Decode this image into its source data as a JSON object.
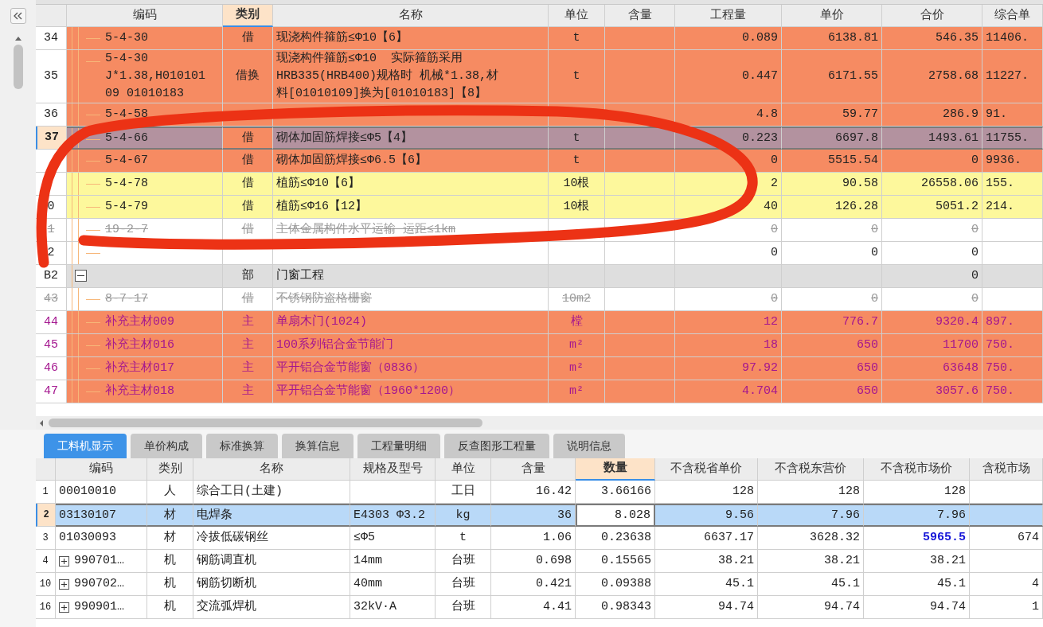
{
  "top_grid": {
    "columns": [
      {
        "label": "编码",
        "highlighted": false
      },
      {
        "label": "类别",
        "highlighted": true
      },
      {
        "label": "名称",
        "highlighted": false
      },
      {
        "label": "单位",
        "highlighted": false
      },
      {
        "label": "含量",
        "highlighted": false
      },
      {
        "label": "工程量",
        "highlighted": false
      },
      {
        "label": "单价",
        "highlighted": false
      },
      {
        "label": "合价",
        "highlighted": false
      },
      {
        "label": "综合单",
        "highlighted": false
      }
    ],
    "rows": [
      {
        "num": "34",
        "kind": "quota",
        "color": "#f68b62",
        "selected": false,
        "code": "5-4-30",
        "type": "借",
        "name": "现浇构件箍筋≤Φ10【6】",
        "unit": "t",
        "quantity": "0.089",
        "unit_price": "6138.81",
        "total": "546.35",
        "composite": "11406."
      },
      {
        "num": "35",
        "kind": "quota",
        "color": "#f68b62",
        "selected": false,
        "code": "5-4-30\nJ*1.38,H010101\n09 01010183",
        "type": "借换",
        "name_lines": [
          "现浇构件箍筋≤Φ10  实际箍筋采用",
          "HRB335(HRB400)规格时 机械*1.38,材",
          "料[01010109]换为[01010183]【8】"
        ],
        "unit": "t",
        "quantity": "0.447",
        "unit_price": "6171.55",
        "total": "2758.68",
        "composite": "11227."
      },
      {
        "num": "36",
        "kind": "quota",
        "color": "#f68b62",
        "selected": false,
        "code": "5-4-58",
        "quantity": "4.8",
        "unit_price": "59.77",
        "total": "286.9",
        "composite": "91."
      },
      {
        "num": "37",
        "kind": "quota",
        "color": "#f68b62",
        "selected": true,
        "code": "5-4-66",
        "type": "借",
        "name": "砌体加固筋焊接≤Φ5【4】",
        "unit": "t",
        "quantity": "0.223",
        "unit_price": "6697.8",
        "total": "1493.61",
        "composite": "11755."
      },
      {
        "kind": "quota",
        "color": "#f68b62",
        "selected": false,
        "code": "5-4-67",
        "type": "借",
        "name": "砌体加固筋焊接≤Φ6.5【6】",
        "unit": "t",
        "quantity": "0",
        "unit_price": "5515.54",
        "total": "0",
        "composite": "9936."
      },
      {
        "kind": "quota",
        "color": "#fdf89c",
        "selected": false,
        "code": "5-4-78",
        "type": "借",
        "name": "植筋≤Φ10【6】",
        "unit": "10根",
        "quantity": "2",
        "unit_price": "90.58",
        "total": "26558.06",
        "composite": "155."
      },
      {
        "num": "0",
        "kind": "quota",
        "color": "#fdf89c",
        "selected": false,
        "code": "5-4-79",
        "type": "借",
        "name": "植筋≤Φ16【12】",
        "unit": "10根",
        "quantity": "40",
        "unit_price": "126.28",
        "total": "5051.2",
        "composite": "214."
      },
      {
        "num": "1",
        "kind": "voided",
        "color": "#ffffff",
        "selected": false,
        "code": "19-2-7",
        "type": "借",
        "name": "主体金属构件水平运输 运距≤1km",
        "quantity": "0",
        "unit_price": "0",
        "total": "0"
      },
      {
        "num": "2",
        "kind": "quota",
        "color": "#ffffff",
        "selected": false,
        "quantity": "0",
        "unit_price": "0",
        "total": "0"
      },
      {
        "num": "B2",
        "kind": "section",
        "color": "#dedede",
        "selected": false,
        "type": "部",
        "name": "门窗工程",
        "total": "0"
      },
      {
        "num": "43",
        "kind": "voided",
        "color": "#ffffff",
        "selected": false,
        "code": "8-7-17",
        "type": "借",
        "name": "不锈钢防盗格栅窗",
        "unit": "10m2",
        "quantity": "0",
        "unit_price": "0",
        "total": "0"
      },
      {
        "num": "44",
        "kind": "material",
        "color": "#f68b62",
        "selected": false,
        "code": "补充主材009",
        "type": "主",
        "name": "单扇木门(1024)",
        "unit": "樘",
        "quantity": "12",
        "unit_price": "776.7",
        "total": "9320.4",
        "composite": "897."
      },
      {
        "num": "45",
        "kind": "material",
        "color": "#f68b62",
        "selected": false,
        "code": "补充主材016",
        "type": "主",
        "name": "100系列铝合金节能门",
        "unit": "m²",
        "quantity": "18",
        "unit_price": "650",
        "total": "11700",
        "composite": "750."
      },
      {
        "num": "46",
        "kind": "material",
        "color": "#f68b62",
        "selected": false,
        "code": "补充主材017",
        "type": "主",
        "name": "平开铝合金节能窗（0836）",
        "unit": "m²",
        "quantity": "97.92",
        "unit_price": "650",
        "total": "63648",
        "composite": "750."
      },
      {
        "num": "47",
        "kind": "material",
        "color": "#f68b62",
        "selected": false,
        "code": "补充主材018",
        "type": "主",
        "name": "平开铝合金节能窗（1960*1200）",
        "unit": "m²",
        "quantity": "4.704",
        "unit_price": "650",
        "total": "3057.6",
        "composite": "750."
      }
    ]
  },
  "detail_tabs": [
    {
      "label": "工料机显示",
      "selected": true
    },
    {
      "label": "单价构成",
      "selected": false
    },
    {
      "label": "标准换算",
      "selected": false
    },
    {
      "label": "换算信息",
      "selected": false
    },
    {
      "label": "工程量明细",
      "selected": false
    },
    {
      "label": "反查图形工程量",
      "selected": false
    },
    {
      "label": "说明信息",
      "selected": false
    }
  ],
  "detail_grid": {
    "columns": [
      {
        "label": "编码",
        "highlighted": false
      },
      {
        "label": "类别",
        "highlighted": false
      },
      {
        "label": "名称",
        "highlighted": false
      },
      {
        "label": "规格及型号",
        "highlighted": false
      },
      {
        "label": "单位",
        "highlighted": false
      },
      {
        "label": "含量",
        "highlighted": false
      },
      {
        "label": "数量",
        "highlighted": true
      },
      {
        "label": "不含税省单价",
        "highlighted": false
      },
      {
        "label": "不含税东营价",
        "highlighted": false
      },
      {
        "label": "不含税市场价",
        "highlighted": false
      },
      {
        "label": "含税市场",
        "highlighted": false
      }
    ],
    "rows": [
      {
        "num": "1",
        "selected": false,
        "expandable": false,
        "price_changed": false,
        "code": "00010010",
        "type": "人",
        "name": "综合工日(土建)",
        "unit": "工日",
        "content": "16.42",
        "quantity": "3.66166",
        "province_price": "128",
        "dongying_price": "128",
        "market_price": "128"
      },
      {
        "num": "2",
        "selected": true,
        "expandable": false,
        "price_changed": false,
        "code": "03130107",
        "type": "材",
        "name": "电焊条",
        "spec": "E4303 Φ3.2",
        "unit": "kg",
        "content": "36",
        "quantity": "8.028",
        "province_price": "9.56",
        "dongying_price": "7.96",
        "market_price": "7.96"
      },
      {
        "num": "3",
        "selected": false,
        "expandable": false,
        "price_changed": true,
        "code": "01030093",
        "type": "材",
        "name": "冷拔低碳钢丝",
        "spec": "≤Φ5",
        "unit": "t",
        "content": "1.06",
        "quantity": "0.23638",
        "province_price": "6637.17",
        "dongying_price": "3628.32",
        "market_price": "5965.5",
        "tax_market_price": "674"
      },
      {
        "num": "4",
        "selected": false,
        "expandable": true,
        "price_changed": false,
        "code": "990701…",
        "type": "机",
        "name": "钢筋调直机",
        "spec": "14mm",
        "unit": "台班",
        "content": "0.698",
        "quantity": "0.15565",
        "province_price": "38.21",
        "dongying_price": "38.21",
        "market_price": "38.21"
      },
      {
        "num": "10",
        "selected": false,
        "expandable": true,
        "price_changed": false,
        "code": "990702…",
        "type": "机",
        "name": "钢筋切断机",
        "spec": "40mm",
        "unit": "台班",
        "content": "0.421",
        "quantity": "0.09388",
        "province_price": "45.1",
        "dongying_price": "45.1",
        "market_price": "45.1",
        "tax_market_price": "4"
      },
      {
        "num": "16",
        "selected": false,
        "expandable": true,
        "price_changed": false,
        "code": "990901…",
        "type": "机",
        "name": "交流弧焊机",
        "spec": "32kV·A",
        "unit": "台班",
        "content": "4.41",
        "quantity": "0.98343",
        "province_price": "94.74",
        "dongying_price": "94.74",
        "market_price": "94.74",
        "tax_market_price": "1"
      }
    ]
  }
}
